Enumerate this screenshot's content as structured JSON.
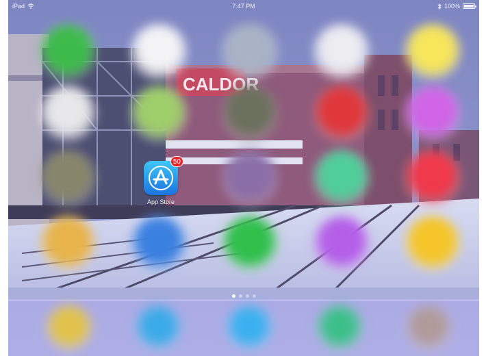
{
  "status_bar": {
    "device": "iPad",
    "time": "7:47 PM",
    "battery_text": "100%",
    "battery_level": 1.0,
    "wifi_icon": "wifi-icon",
    "bluetooth_icon": "bluetooth-icon",
    "battery_icon": "battery-icon"
  },
  "wallpaper": {
    "sign_text": "CALDOR"
  },
  "home_screen": {
    "app_store": {
      "label": "App Store",
      "badge": "50",
      "icon": "app-store-icon"
    },
    "blurred_app_colors": [
      [
        "#3dbb4a",
        "#f4f4f6",
        "#a9b3c4",
        "#ececf1",
        "#f7e65a"
      ],
      [
        "#e8e8ea",
        "#9fcf6a",
        "#6a705c",
        "#e0373a",
        "#d064e6"
      ],
      [
        "#88866a",
        null,
        "#8a6ea8",
        "#4fcf9a",
        "#f0394a"
      ],
      [
        "#e7b34a",
        "#3a80e0",
        "#2fbf4a",
        "#b45ee8",
        "#f5c52a"
      ]
    ],
    "pages": {
      "count": 4,
      "active": 0
    }
  },
  "dock": {
    "blurred_app_colors": [
      "#e1c24a",
      "#3aaae8",
      "#3ab0f0",
      "#3cbf8a",
      "#b09a9a"
    ]
  },
  "colors": {
    "badge": "#e7242b",
    "sky": "#6e78b4",
    "snow": "#dcdcf0"
  }
}
